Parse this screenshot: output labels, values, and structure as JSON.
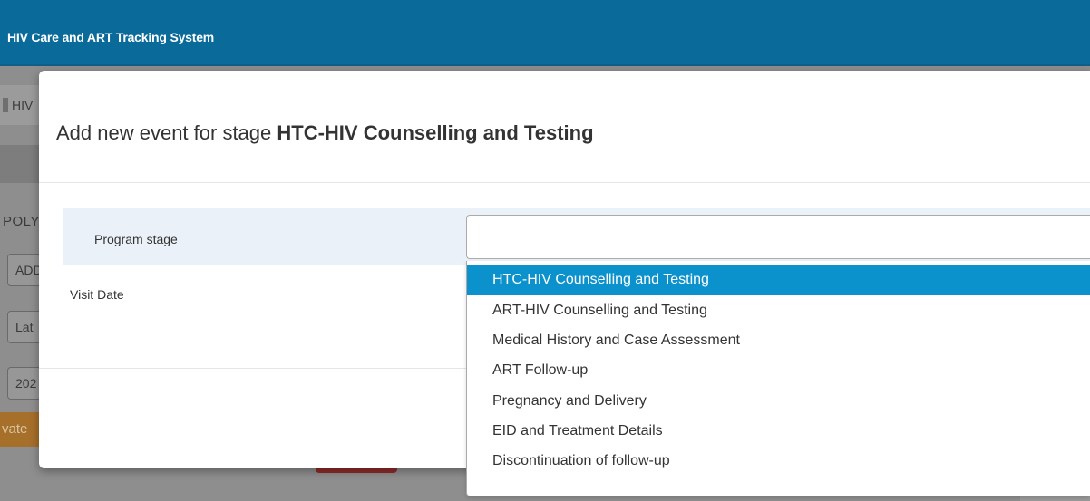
{
  "app": {
    "title": "HIV Care and ART Tracking System"
  },
  "background": {
    "tab_label": "HIV",
    "heading": "POLY",
    "fields": [
      "ADD",
      "Lat",
      "202"
    ],
    "orange_button": "vate"
  },
  "modal": {
    "title_prefix": "Add new event for stage ",
    "title_stage": "HTC-HIV Counselling and Testing",
    "program_stage_label": "Program stage",
    "visit_date_label": "Visit Date",
    "program_stage_value": ""
  },
  "dropdown": {
    "selected_index": 0,
    "options": [
      "HTC-HIV Counselling and Testing",
      "ART-HIV Counselling and Testing",
      "Medical History and Case Assessment",
      "ART Follow-up",
      "Pregnancy and Delivery",
      "EID and Treatment Details",
      "Discontinuation of follow-up"
    ]
  },
  "colors": {
    "topbar": "#0a6a99",
    "highlight": "#0b91cc",
    "stage_row": "#eaf1f8"
  }
}
